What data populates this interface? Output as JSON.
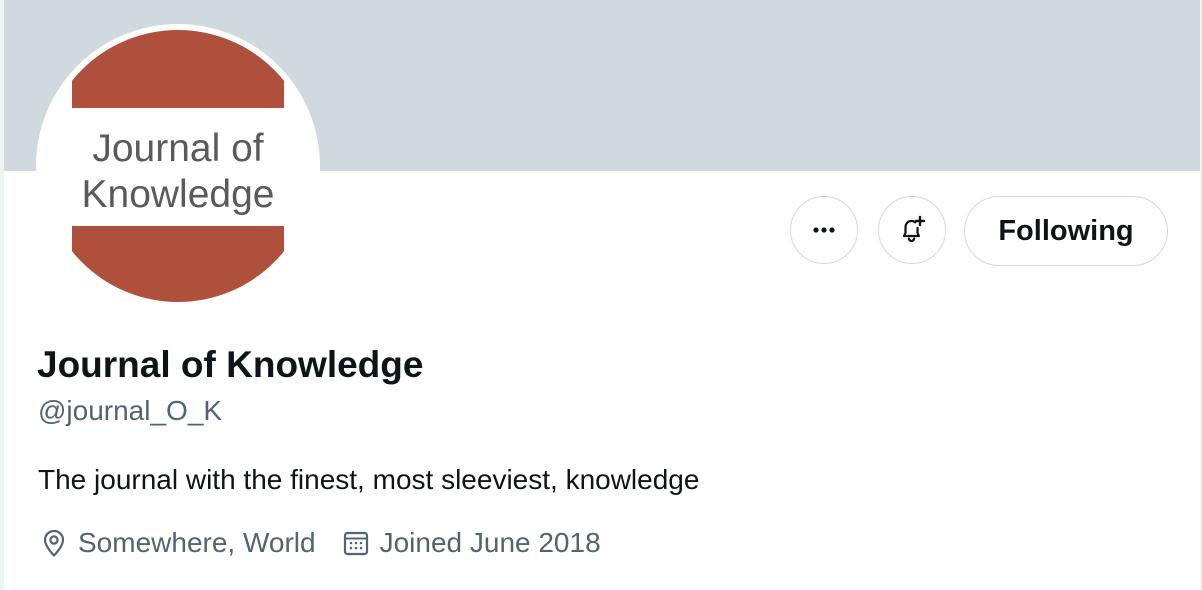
{
  "profile": {
    "avatar_text_line1": "Journal of",
    "avatar_text_line2": "Knowledge",
    "display_name": "Journal of Knowledge",
    "handle": "@journal_O_K",
    "bio": "The journal with the finest, most sleeviest, knowledge",
    "location": "Somewhere, World",
    "joined": "Joined June 2018"
  },
  "actions": {
    "more_icon": "more-horizontal-icon",
    "notify_icon": "bell-plus-icon",
    "following_label": "Following"
  },
  "colors": {
    "banner": "#cfd9de",
    "avatar_brand": "#b5533e",
    "text_primary": "#0f1419",
    "text_secondary": "#536471",
    "border": "#cfd9de"
  }
}
